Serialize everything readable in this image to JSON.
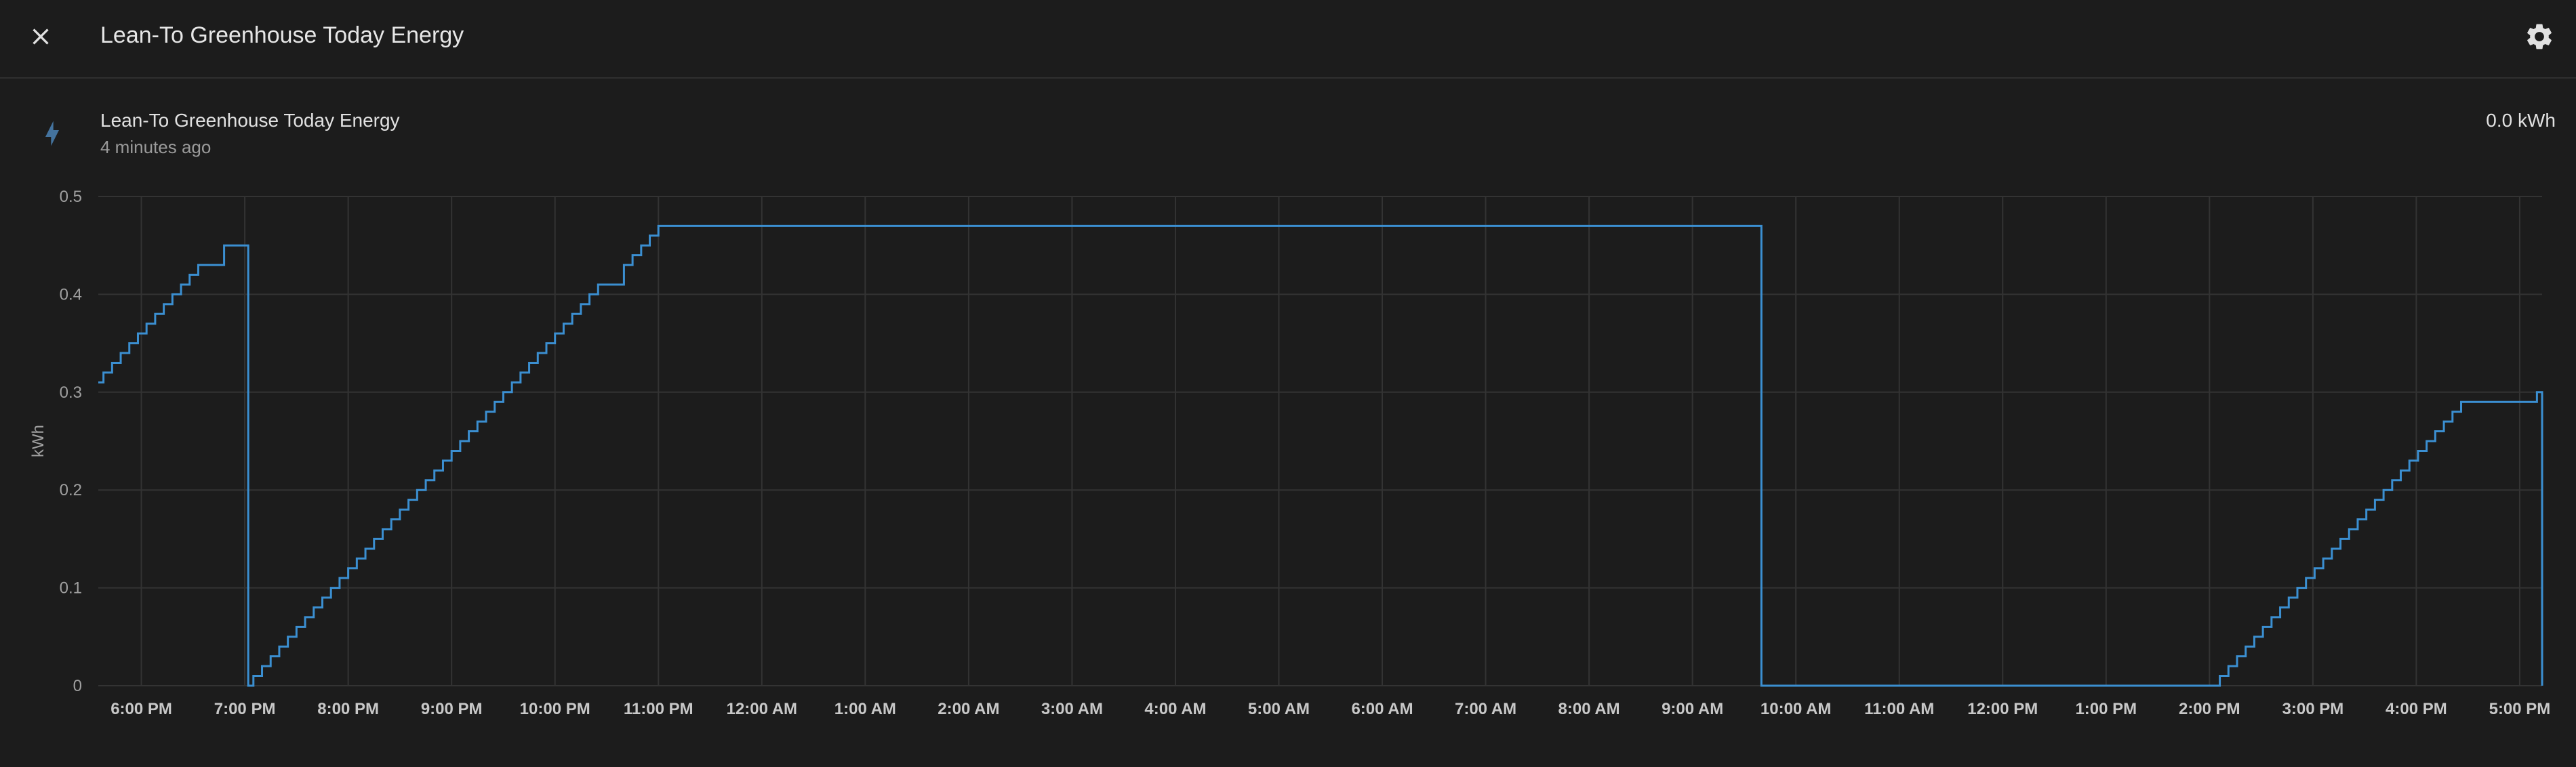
{
  "header": {
    "title": "Lean-To Greenhouse Today Energy",
    "close_icon": "close-icon",
    "settings_icon": "gear-icon"
  },
  "entity": {
    "icon": "lightning-bolt-icon",
    "name": "Lean-To Greenhouse Today Energy",
    "last_changed": "4 minutes ago",
    "state": "0.0 kWh"
  },
  "colors": {
    "background": "#1c1c1c",
    "line": "#3b8fd1",
    "grid": "#333333",
    "icon_accent": "#44739e"
  },
  "chart_data": {
    "type": "line",
    "step": true,
    "ylabel": "kWh",
    "ylim": [
      0,
      0.5
    ],
    "yticks": [
      "0",
      "0.1",
      "0.2",
      "0.3",
      "0.4",
      "0.5"
    ],
    "xticks": [
      "6:00 PM",
      "7:00 PM",
      "8:00 PM",
      "9:00 PM",
      "10:00 PM",
      "11:00 PM",
      "12:00 AM",
      "1:00 AM",
      "2:00 AM",
      "3:00 AM",
      "4:00 AM",
      "5:00 AM",
      "6:00 AM",
      "7:00 AM",
      "8:00 AM",
      "9:00 AM",
      "10:00 AM",
      "11:00 AM",
      "12:00 PM",
      "1:00 PM",
      "2:00 PM",
      "3:00 PM",
      "4:00 PM",
      "5:00 PM"
    ],
    "xlim": [
      "5:35 PM",
      "5:13 PM"
    ],
    "grid": true,
    "series": [
      {
        "x": [
          "5:35 PM",
          "5:38 PM",
          "5:43 PM",
          "5:48 PM",
          "5:53 PM",
          "5:58 PM",
          "6:03 PM",
          "6:08 PM",
          "6:13 PM",
          "6:18 PM",
          "6:23 PM",
          "6:28 PM",
          "6:33 PM",
          "6:38 PM",
          "6:43 PM",
          "6:48 PM",
          "6:55 PM",
          "7:02 PM",
          "7:05 PM",
          "7:10 PM",
          "7:15 PM",
          "7:20 PM",
          "7:25 PM",
          "7:30 PM",
          "7:35 PM",
          "7:40 PM",
          "7:45 PM",
          "7:50 PM",
          "7:55 PM",
          "8:00 PM",
          "8:05 PM",
          "8:10 PM",
          "8:15 PM",
          "8:20 PM",
          "8:25 PM",
          "8:30 PM",
          "8:35 PM",
          "8:40 PM",
          "8:45 PM",
          "8:50 PM",
          "8:55 PM",
          "9:00 PM",
          "9:05 PM",
          "9:10 PM",
          "9:15 PM",
          "9:20 PM",
          "9:25 PM",
          "9:30 PM",
          "9:35 PM",
          "9:40 PM",
          "9:45 PM",
          "9:50 PM",
          "9:55 PM",
          "10:00 PM",
          "10:05 PM",
          "10:10 PM",
          "10:15 PM",
          "10:20 PM",
          "10:25 PM",
          "10:30 PM",
          "10:35 PM",
          "10:40 PM",
          "10:45 PM",
          "10:50 PM",
          "10:55 PM",
          "11:00 PM",
          "11:05 PM",
          "11:10 PM",
          "11:15 PM",
          "11:20 PM",
          "11:30 PM",
          "11:35 PM",
          "11:40 PM",
          "11:45 PM",
          "11:50 PM",
          "11:55 PM",
          "9:40 AM",
          "2:03 PM",
          "2:06 PM",
          "2:11 PM",
          "2:16 PM",
          "2:21 PM",
          "2:26 PM",
          "2:31 PM",
          "2:36 PM",
          "2:41 PM",
          "2:46 PM",
          "2:51 PM",
          "2:56 PM",
          "3:01 PM",
          "3:06 PM",
          "3:11 PM",
          "3:16 PM",
          "3:21 PM",
          "3:26 PM",
          "3:31 PM",
          "3:36 PM",
          "3:41 PM",
          "3:46 PM",
          "3:51 PM",
          "3:56 PM",
          "4:01 PM",
          "4:06 PM",
          "4:11 PM",
          "4:16 PM",
          "4:21 PM",
          "4:26 PM",
          "4:31 PM",
          "4:36 PM",
          "4:41 PM",
          "4:46 PM",
          "4:51 PM",
          "4:56 PM",
          "5:01 PM",
          "5:06 PM",
          "5:10 PM",
          "5:13 PM"
        ],
        "y": [
          0.31,
          0.32,
          0.33,
          0.34,
          0.35,
          0.36,
          0.37,
          0.38,
          0.39,
          0.4,
          0.41,
          0.42,
          0.43,
          0.43,
          0.43,
          0.45,
          0.45,
          0.0,
          0.01,
          0.02,
          0.03,
          0.04,
          0.05,
          0.06,
          0.07,
          0.08,
          0.09,
          0.1,
          0.11,
          0.12,
          0.13,
          0.14,
          0.15,
          0.16,
          0.17,
          0.18,
          0.19,
          0.2,
          0.21,
          0.22,
          0.23,
          0.24,
          0.25,
          0.26,
          0.27,
          0.28,
          0.29,
          0.3,
          0.31,
          0.32,
          0.33,
          0.34,
          0.35,
          0.36,
          0.37,
          0.38,
          0.39,
          0.4,
          0.41,
          0.41,
          0.41,
          0.43,
          0.44,
          0.45,
          0.46,
          0.47,
          0.47,
          0.47,
          0.47,
          0.47,
          0.47,
          0.47,
          0.47,
          0.47,
          0.47,
          0.47,
          0.0,
          0.0,
          0.01,
          0.02,
          0.03,
          0.04,
          0.05,
          0.06,
          0.07,
          0.08,
          0.09,
          0.1,
          0.11,
          0.12,
          0.13,
          0.14,
          0.15,
          0.16,
          0.17,
          0.18,
          0.19,
          0.2,
          0.21,
          0.22,
          0.23,
          0.24,
          0.25,
          0.26,
          0.27,
          0.28,
          0.29,
          0.29,
          0.29,
          0.29,
          0.29,
          0.29,
          0.29,
          0.29,
          0.29,
          0.3,
          0.0
        ]
      }
    ]
  }
}
